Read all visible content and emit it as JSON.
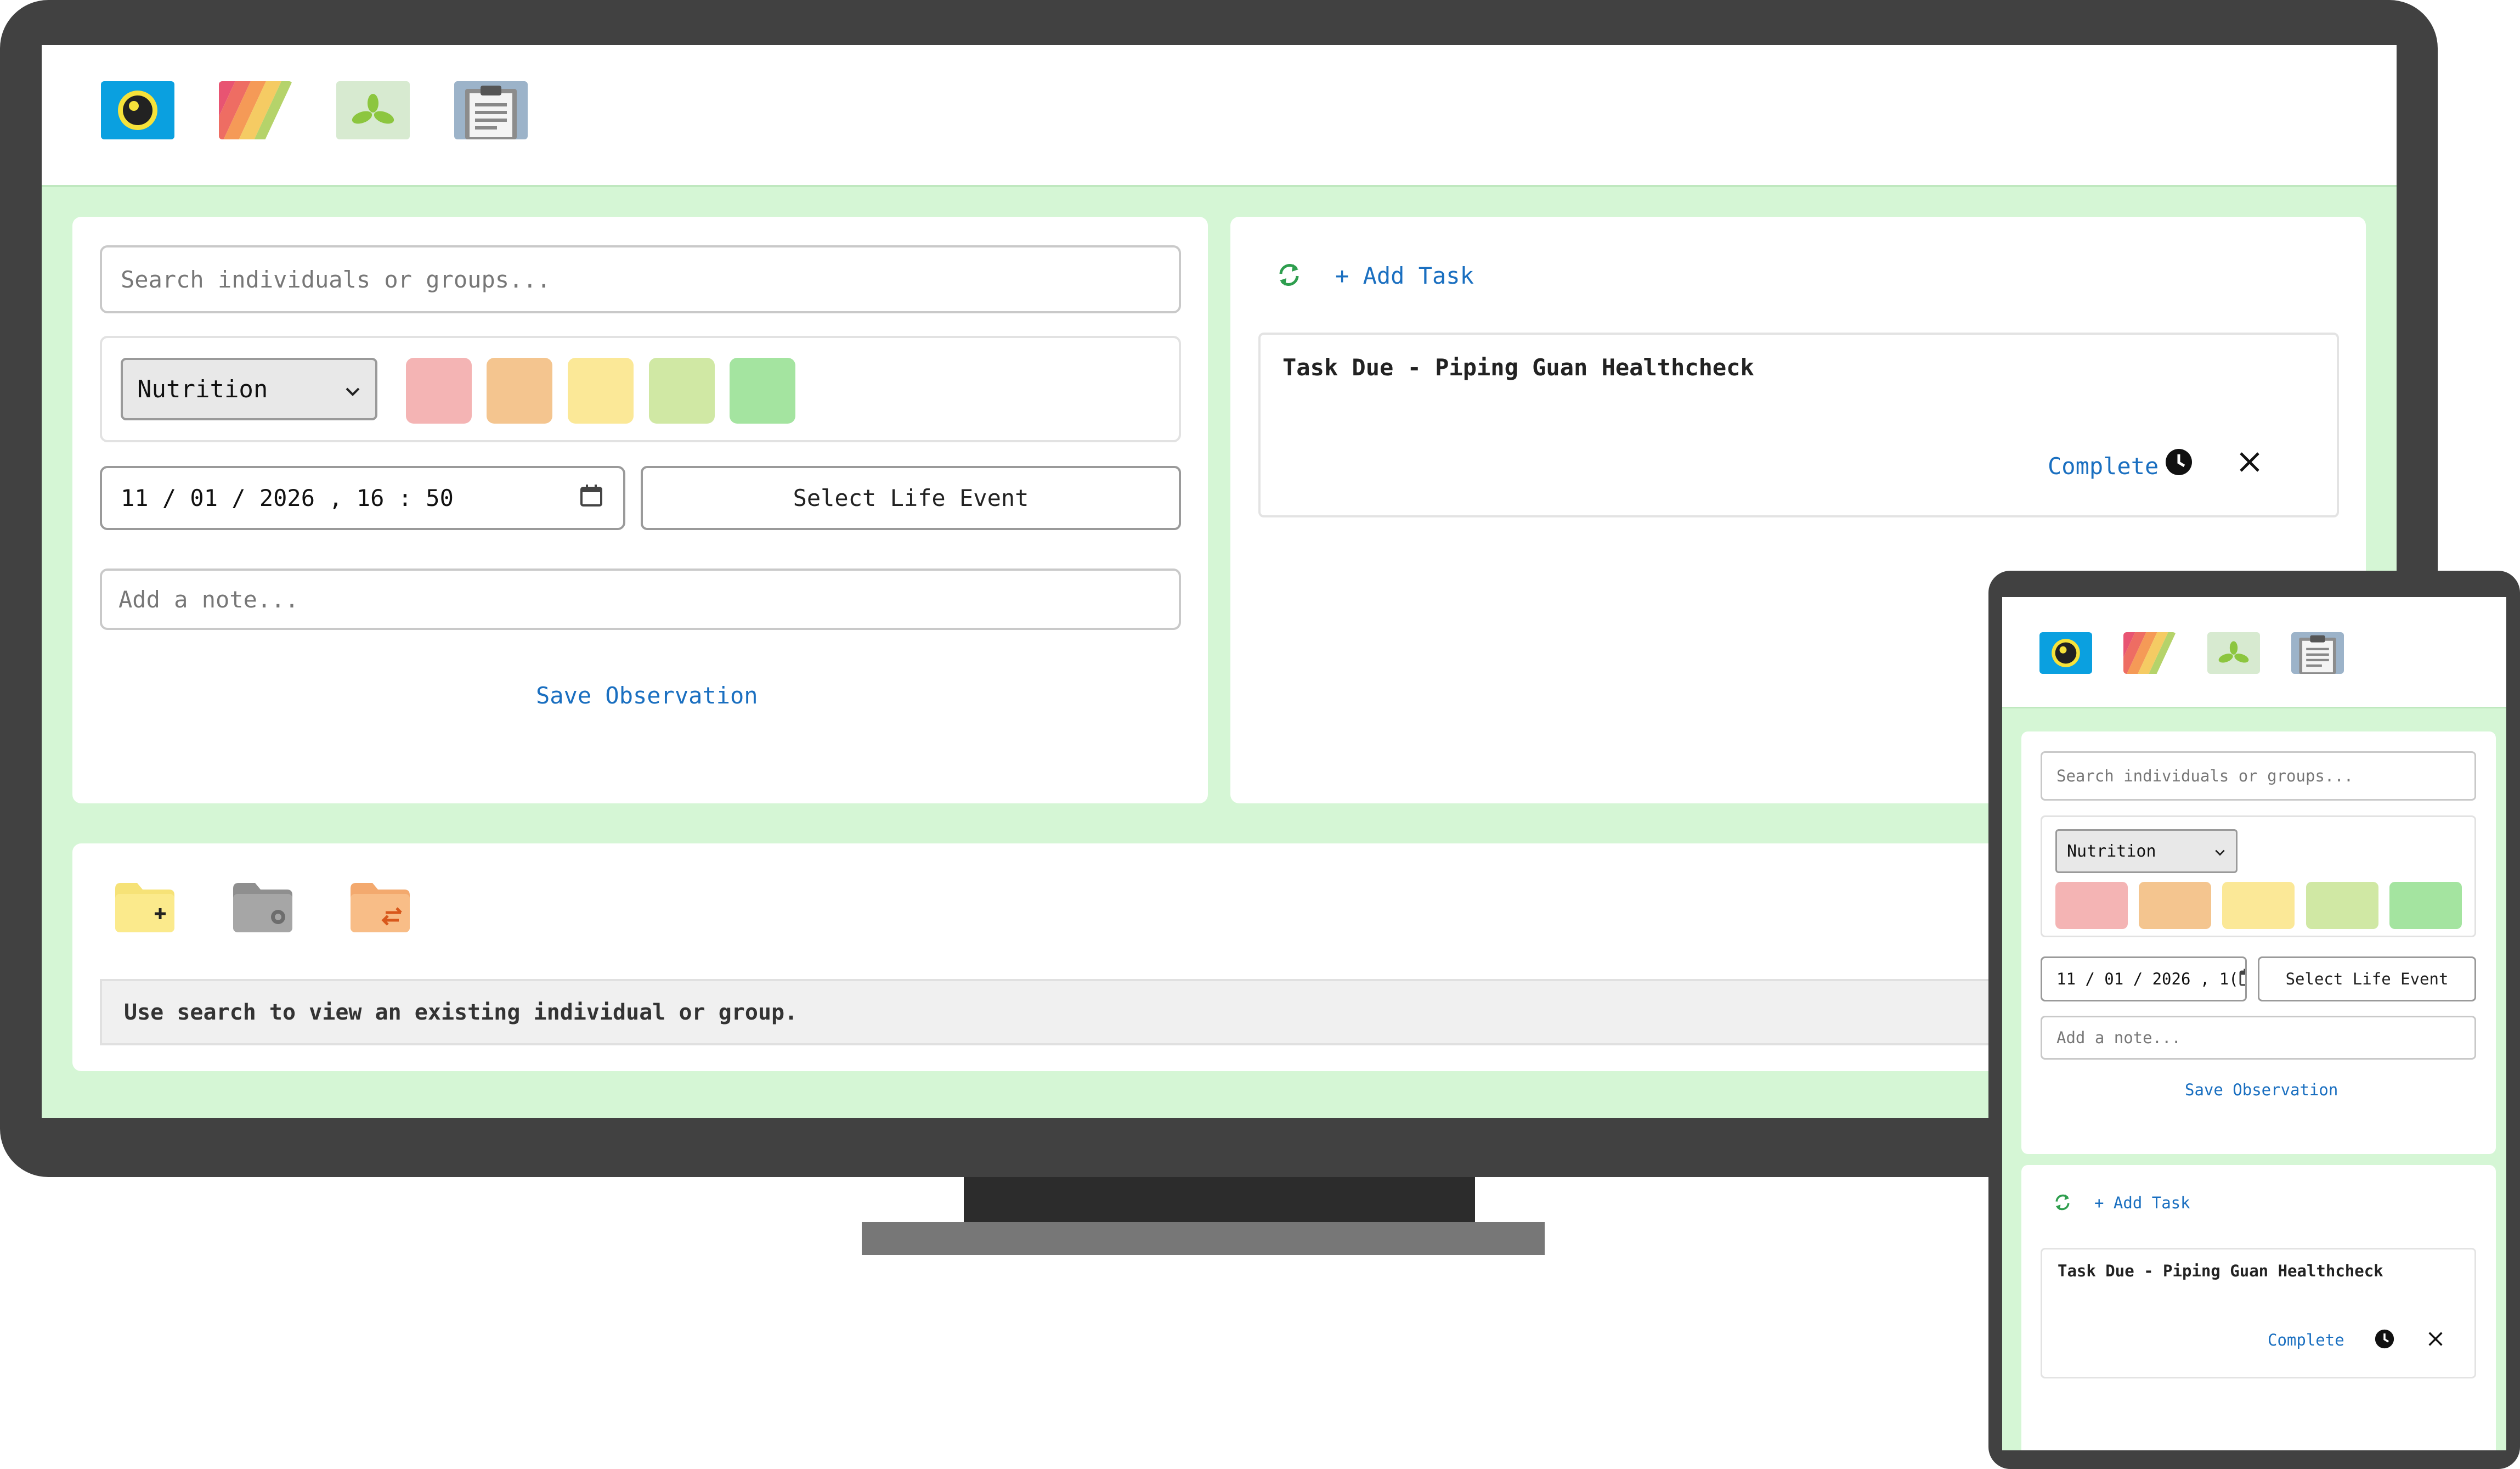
{
  "apps": [
    {
      "icon": "camera-eye-icon"
    },
    {
      "icon": "rainbow-stripes-icon"
    },
    {
      "icon": "leaf-sprout-icon"
    },
    {
      "icon": "clipboard-icon"
    }
  ],
  "observation": {
    "search_placeholder": "Search individuals or groups...",
    "category_selected": "Nutrition",
    "scale_colors": [
      "#f4b4b4",
      "#f4c58f",
      "#fbe897",
      "#d0e8a4",
      "#a4e4a0"
    ],
    "date_value": "11 / 01 / 2026 ,  16 : 50",
    "date_value_mobile": "11 / 01 / 2026 ,  1(",
    "life_event_label": "Select Life Event",
    "note_placeholder": "Add a note...",
    "save_label": "Save Observation"
  },
  "tasks": {
    "add_label": "+ Add Task",
    "items": [
      {
        "title": "Task Due - Piping Guan Healthcheck",
        "complete_label": "Complete"
      }
    ]
  },
  "records": {
    "message": "Use search to view an existing individual or group."
  },
  "colors": {
    "screen_bg": "#d5f6d5",
    "link": "#1a6fc0",
    "refresh_green": "#2e9e4e",
    "bezel": "#414141"
  }
}
